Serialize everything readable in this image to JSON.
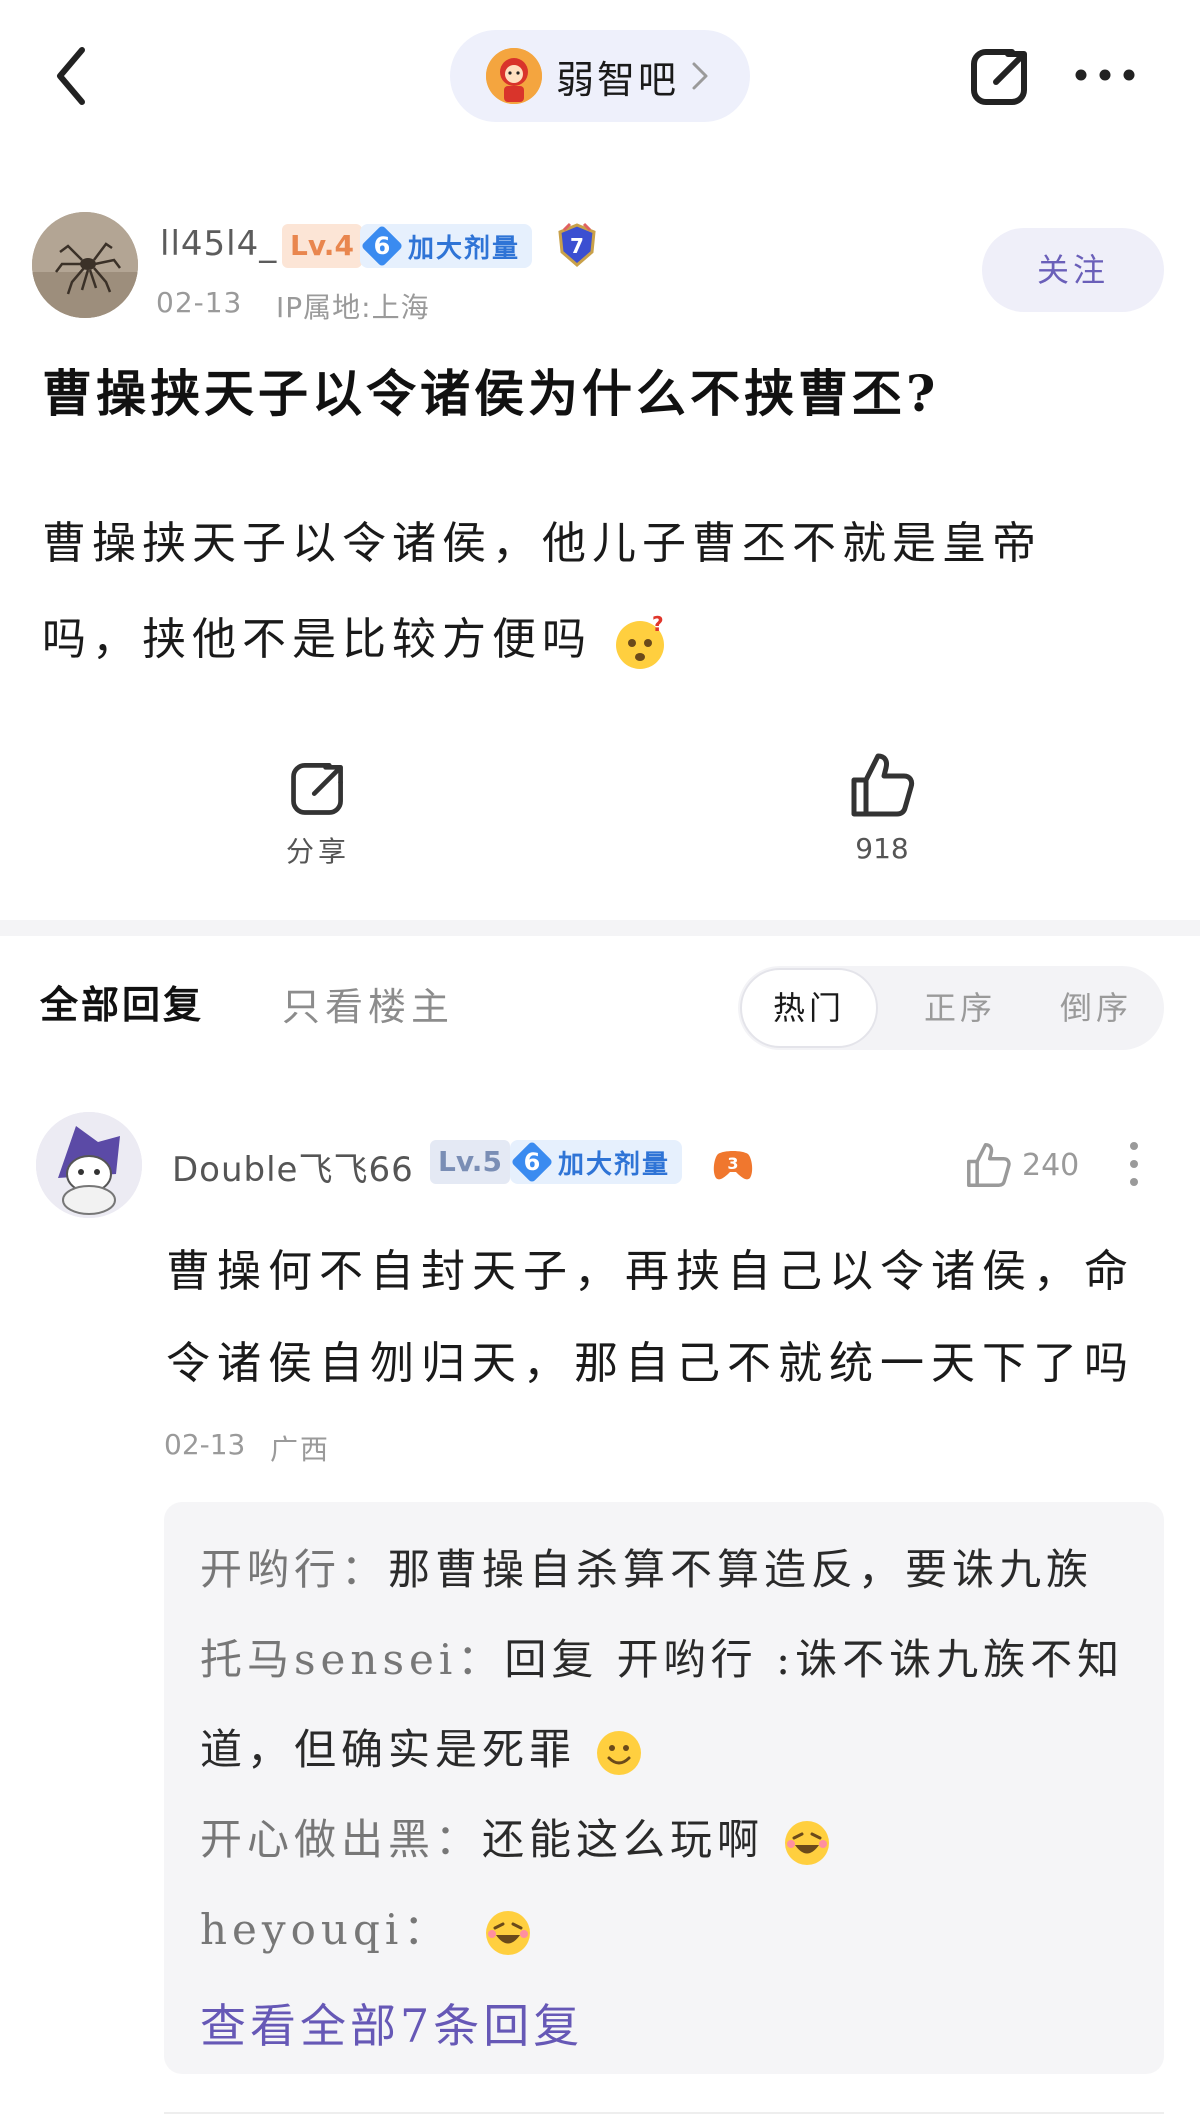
{
  "top_bar": {
    "forum_name": "弱智吧"
  },
  "post": {
    "author": {
      "name": "ll45l4_",
      "level": "Lv.4",
      "badge_number": "6",
      "badge_text": "加大剂量",
      "extra_badge_number": "7"
    },
    "date": "02-13",
    "ip_location": "IP属地:上海",
    "follow_label": "关注",
    "title": "曹操挟天子以令诸侯为什么不挟曹丕?",
    "body_line_1": "曹操挟天子以令诸侯，他儿子曹丕不就是皇帝",
    "body_line_2": "吗，挟他不是比较方便吗",
    "share_label": "分享",
    "like_count": "918"
  },
  "replies_header": {
    "tab_all": "全部回复",
    "tab_op_only": "只看楼主",
    "sort_hot": "热门",
    "sort_asc": "正序",
    "sort_desc": "倒序"
  },
  "comment": {
    "author": "Double飞飞66",
    "level": "Lv.5",
    "badge_number": "6",
    "badge_text": "加大剂量",
    "like_count": "240",
    "body_line_1": "曹操何不自封天子，再挟自己以令诸侯，命",
    "body_line_2": "令诸侯自刎归天，那自己不就统一天下了吗",
    "date": "02-13",
    "region": "广西",
    "sub_replies": [
      {
        "author": "开哟行：",
        "text": "那曹操自杀算不算造反，要诛九族"
      },
      {
        "author": "托马sensei：",
        "text": "回复 开哟行 :诛不诛九族不知"
      },
      {
        "author": "",
        "text": "道，但确实是死罪"
      },
      {
        "author": "开心做出黑：",
        "text": "还能这么玩啊"
      },
      {
        "author": "heyouqi：",
        "text": ""
      }
    ],
    "view_all_label": "查看全部7条回复"
  }
}
